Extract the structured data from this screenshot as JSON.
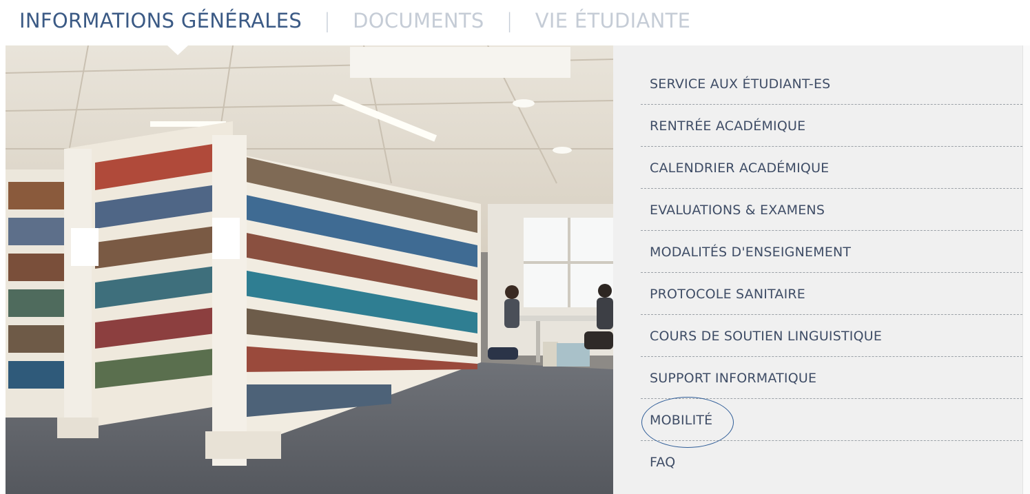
{
  "tabs": [
    {
      "label": "INFORMATIONS GÉNÉRALES",
      "active": true
    },
    {
      "label": "DOCUMENTS",
      "active": false
    },
    {
      "label": "VIE ÉTUDIANTE",
      "active": false
    }
  ],
  "tab_separator": "|",
  "photo": {
    "subject": "library-bookshelves-with-students-photo"
  },
  "menu": {
    "items": [
      {
        "label": "SERVICE AUX ÉTUDIANT-ES"
      },
      {
        "label": "RENTRÉE ACADÉMIQUE"
      },
      {
        "label": "CALENDRIER ACADÉMIQUE"
      },
      {
        "label": "EVALUATIONS & EXAMENS"
      },
      {
        "label": "MODALITÉS D'ENSEIGNEMENT"
      },
      {
        "label": "PROTOCOLE SANITAIRE"
      },
      {
        "label": "COURS DE SOUTIEN LINGUISTIQUE"
      },
      {
        "label": "SUPPORT INFORMATIQUE"
      },
      {
        "label": "MOBILITÉ",
        "annotation": "circled"
      },
      {
        "label": "FAQ"
      }
    ]
  },
  "colors": {
    "active_tab": "#3b5a85",
    "inactive_tab": "#c5ccd6",
    "menu_text": "#3f4d66",
    "menu_background": "#f0f0f0",
    "annotation_circle": "#2f5d98"
  }
}
